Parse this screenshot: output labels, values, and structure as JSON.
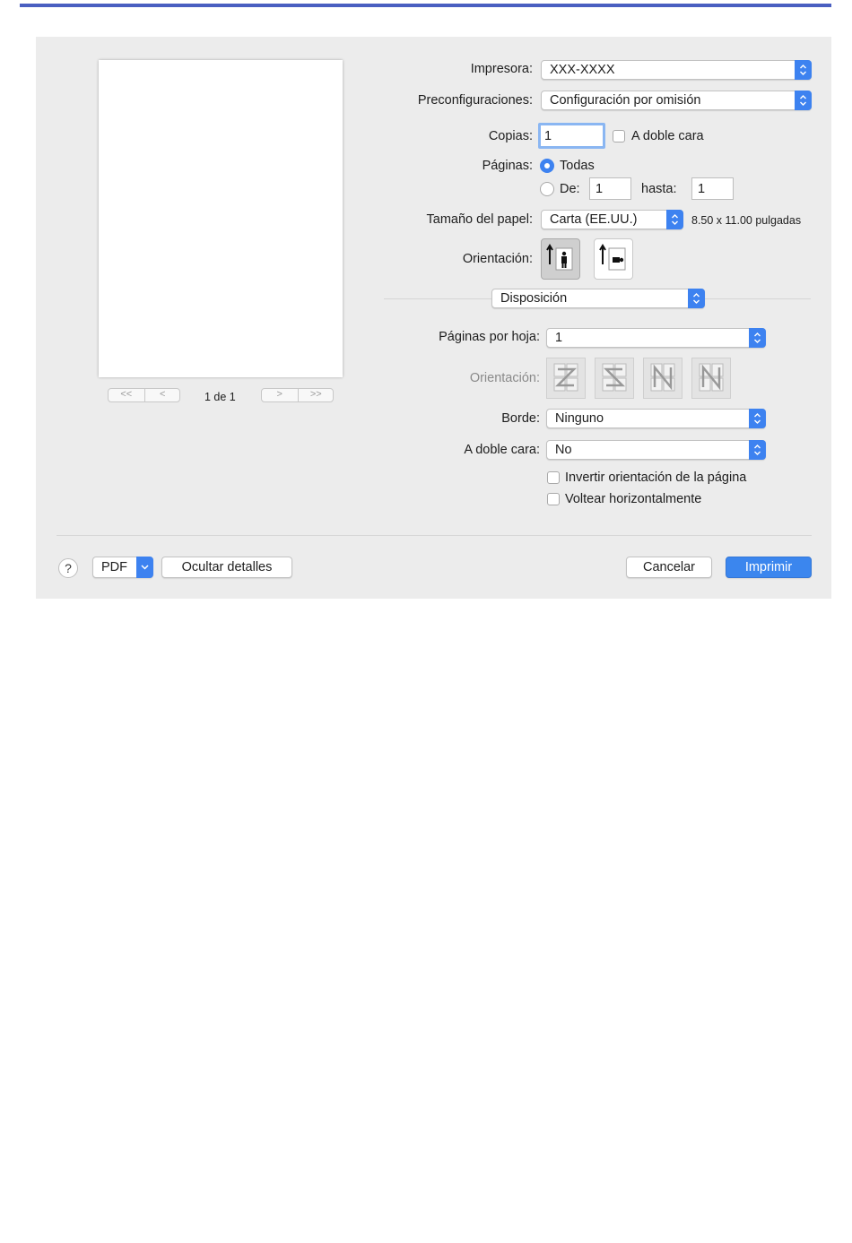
{
  "printer": {
    "label": "Impresora:",
    "value": "XXX-XXXX"
  },
  "presets": {
    "label": "Preconfiguraciones:",
    "value": "Configuración por omisión"
  },
  "copies": {
    "label": "Copias:",
    "value": "1",
    "duplex_label": "A doble cara"
  },
  "pages": {
    "label": "Páginas:",
    "all_label": "Todas",
    "from_label": "De:",
    "from_value": "1",
    "to_label": "hasta:",
    "to_value": "1"
  },
  "paper": {
    "label": "Tamaño del papel:",
    "value": "Carta (EE.UU.)",
    "dimensions": "8.50 x 11.00 pulgadas"
  },
  "orientation": {
    "label": "Orientación:"
  },
  "section": {
    "value": "Disposición"
  },
  "layout": {
    "pages_per_sheet_label": "Páginas por hoja:",
    "pages_per_sheet_value": "1",
    "direction_label": "Orientación:",
    "border_label": "Borde:",
    "border_value": "Ninguno",
    "two_sided_label": "A doble cara:",
    "two_sided_value": "No",
    "reverse_label": "Invertir orientación de la página",
    "flip_label": "Voltear horizontalmente"
  },
  "preview": {
    "page_counter": "1 de 1",
    "first_glyph": "<<",
    "prev_glyph": "<",
    "next_glyph": ">",
    "last_glyph": ">>"
  },
  "footer": {
    "help": "?",
    "pdf": "PDF",
    "hide_details": "Ocultar detalles",
    "cancel": "Cancelar",
    "print": "Imprimir"
  },
  "colors": {
    "accent": "#3d82f0",
    "title_bar": "#4a5fc1",
    "panel": "#ececec"
  }
}
